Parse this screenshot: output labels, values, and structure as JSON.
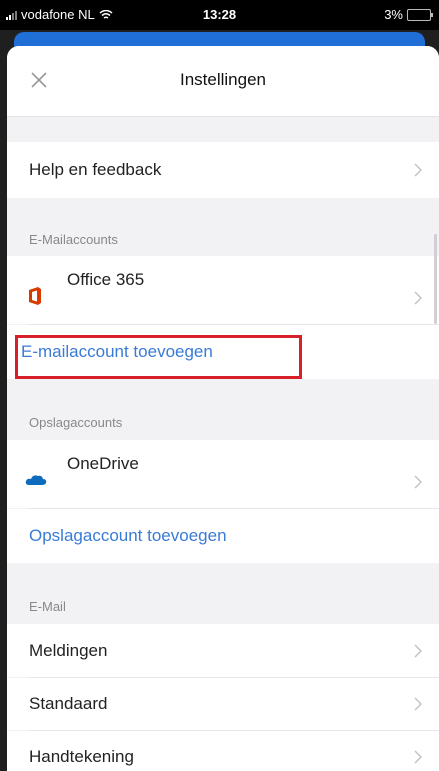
{
  "status_bar": {
    "carrier": "vodafone NL",
    "time": "13:28",
    "battery": "3%"
  },
  "nav": {
    "title": "Instellingen"
  },
  "rows": {
    "help": "Help en feedback",
    "office": "Office 365",
    "add_mail": "E-mailaccount toevoegen",
    "onedrive": "OneDrive",
    "add_storage": "Opslagaccount toevoegen",
    "meldingen": "Meldingen",
    "standaard": "Standaard",
    "handtekening": "Handtekening"
  },
  "sections": {
    "mail_accounts": "E-Mailaccounts",
    "storage_accounts": "Opslagaccounts",
    "mail": "E-Mail"
  },
  "colors": {
    "link": "#3a7bd5",
    "highlight": "#d8202a",
    "office_logo": "#d83b01",
    "onedrive": "#0f6cbd"
  }
}
